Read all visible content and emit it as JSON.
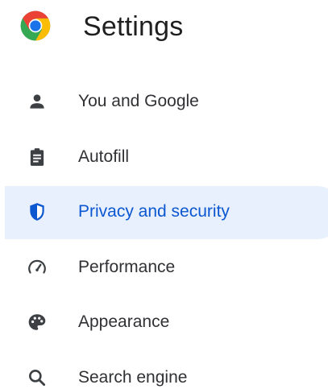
{
  "header": {
    "title": "Settings",
    "logo_icon": "chrome-logo-icon"
  },
  "colors": {
    "active_bg": "#e8f0fe",
    "active_text": "#0b57d0",
    "text": "#303134",
    "icon": "#3c4043"
  },
  "nav": {
    "items": [
      {
        "label": "You and Google",
        "icon": "person-icon",
        "active": false
      },
      {
        "label": "Autofill",
        "icon": "clipboard-icon",
        "active": false
      },
      {
        "label": "Privacy and security",
        "icon": "shield-icon",
        "active": true
      },
      {
        "label": "Performance",
        "icon": "speedometer-icon",
        "active": false
      },
      {
        "label": "Appearance",
        "icon": "palette-icon",
        "active": false
      },
      {
        "label": "Search engine",
        "icon": "search-icon",
        "active": false
      }
    ]
  }
}
